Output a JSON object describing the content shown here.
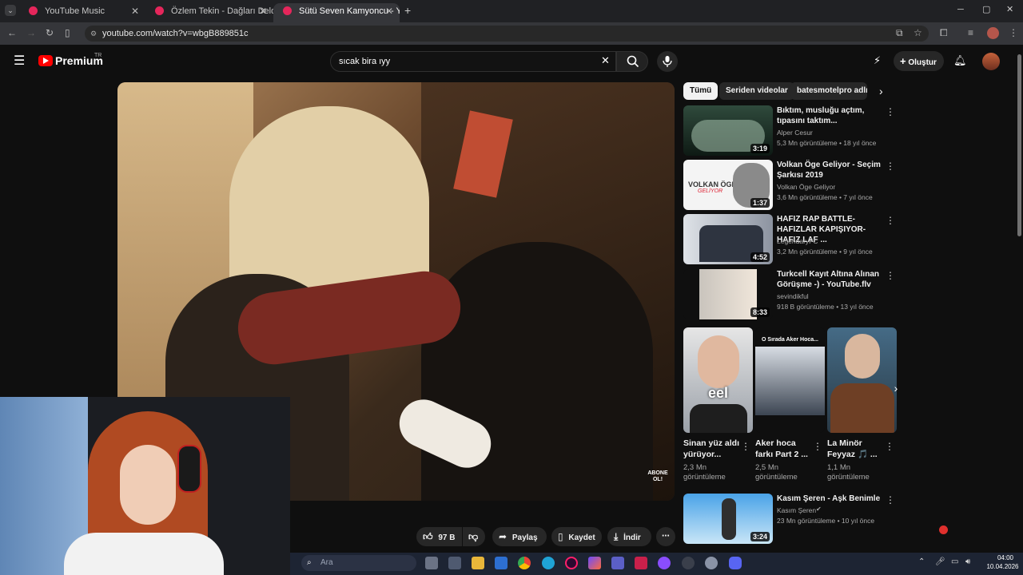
{
  "browser": {
    "tabs": [
      {
        "title": "YouTube Music"
      },
      {
        "title": "Özlem Tekin - Dağları Deldim -"
      },
      {
        "title": "Sütü Seven Kamyoncu - YouTub"
      }
    ],
    "url": "youtube.com/watch?v=wbgB889851c"
  },
  "header": {
    "logo": "Premium",
    "region": "TR",
    "search_value": "sıcak bira ıyy",
    "create_label": "Oluştur"
  },
  "video": {
    "watermark": "ABONE OL!",
    "likes": "97 B",
    "share_label": "Paylaş",
    "save_label": "Kaydet",
    "download_label": "İndir"
  },
  "chips": [
    "Tümü",
    "Seriden videolar",
    "batesmotelpro adlı yü"
  ],
  "recommendations": [
    {
      "title": "Bıktım, musluğu açtım, tıpasını taktım...",
      "channel": "Alper Cesur",
      "meta": "5,3 Mn görüntüleme • 18 yıl önce",
      "duration": "3:19"
    },
    {
      "title": "Volkan Öge Geliyor - Seçim Şarkısı 2019",
      "channel": "Volkan Öge Geliyor",
      "meta": "3,6 Mn görüntüleme • 7 yıl önce",
      "duration": "1:37",
      "thumb_text": "VOLKAN ÖGE",
      "thumb_sub": "GELİYOR"
    },
    {
      "title": "HAFIZ RAP BATTLE-HAFIZLAR KAPIŞIYOR-HAFIZ LAF ...",
      "channel": "LegendaryFC",
      "meta": "3,2 Mn görüntüleme • 9 yıl önce",
      "duration": "4:52"
    },
    {
      "title": "Turkcell Kayıt Altına Alınan Görüşme -) - YouTube.flv",
      "channel": "sevindikful",
      "meta": "918 B görüntüleme • 13 yıl önce",
      "duration": "8:33"
    }
  ],
  "shorts": [
    {
      "title": "Sinan yüz aldı yürüyor...",
      "views": "2,3 Mn görüntüleme",
      "overlay": "eel"
    },
    {
      "title": "Aker hoca farkı Part 2 ...",
      "views": "2,5 Mn görüntüleme",
      "overlay": "O Sırada Aker Hoca..."
    },
    {
      "title": "La Minör Feyyaz 🎵 ...",
      "views": "1,1 Mn görüntüleme"
    }
  ],
  "last_rec": {
    "title": "Kasım Şeren - Aşk Benimle",
    "channel": "Kasım Şeren",
    "meta": "23 Mn görüntüleme • 10 yıl önce",
    "duration": "3:24"
  },
  "taskbar": {
    "search_placeholder": "Ara",
    "time": "04:00",
    "date": "10.04.2026"
  },
  "colors": {
    "accent_red": "#ff0000",
    "bg": "#0f0f0f"
  }
}
